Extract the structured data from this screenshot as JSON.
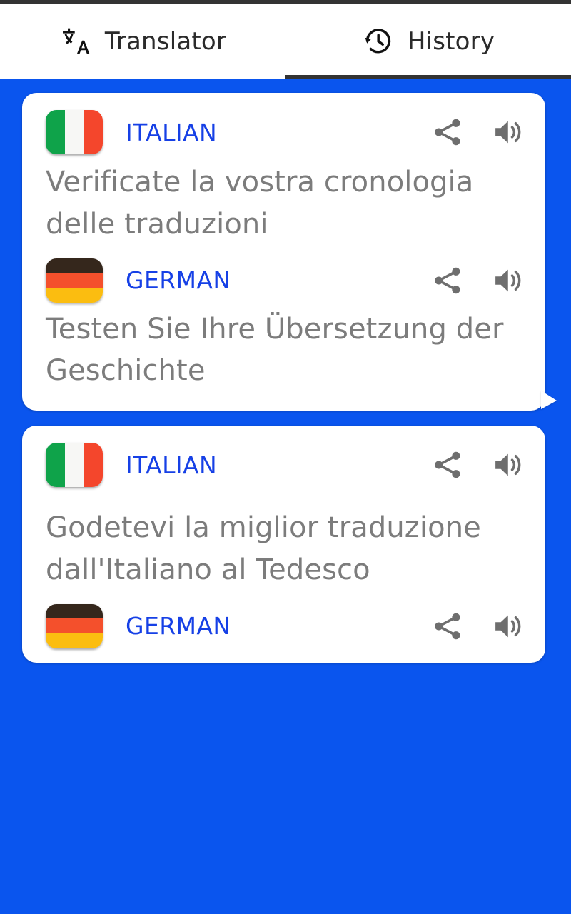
{
  "window": {
    "status_strip_color": "#333333",
    "background_color": "#0a55ee",
    "card_color": "#ffffff"
  },
  "tabs": [
    {
      "id": "translator",
      "label": "Translator",
      "icon": "translate-icon",
      "active": false
    },
    {
      "id": "history",
      "label": "History",
      "icon": "history-clock-icon",
      "active": true
    }
  ],
  "colors": {
    "language_label": "#1640e6",
    "body_text": "#7c7c7c",
    "tab_label": "#2b2b2b",
    "accent_blue": "#0a55ee",
    "indicator": "#333333"
  },
  "actions": {
    "share_label": "share-icon",
    "speak_label": "volume-icon"
  },
  "cards": [
    {
      "id": "card-1",
      "has_tail": true,
      "entries": [
        {
          "flag": "italy-flag",
          "language": "ITALIAN",
          "text": "Verificate la vostra cronologia delle traduzioni"
        },
        {
          "flag": "germany-flag",
          "language": "GERMAN",
          "text": "Testen Sie Ihre Übersetzung der Geschichte"
        }
      ]
    },
    {
      "id": "card-2",
      "has_tail": false,
      "entries": [
        {
          "flag": "italy-flag",
          "language": "ITALIAN",
          "text": "Godetevi la miglior traduzione dall'Italiano al Tedesco"
        },
        {
          "flag": "germany-flag",
          "language": "GERMAN",
          "text": ""
        }
      ]
    }
  ]
}
